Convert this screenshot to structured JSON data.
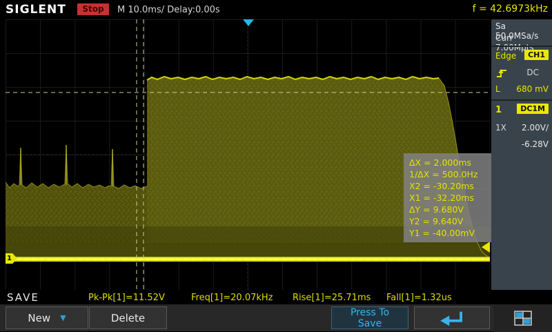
{
  "colors": {
    "accent_yellow": "#e8e800",
    "accent_cyan": "#2fb0e0",
    "stop_red": "#c53232",
    "trace_olive": "#5a5a0f",
    "sidebar_gray": "#39434b"
  },
  "top_bar": {
    "brand": "SIGLENT",
    "run_state": "Stop",
    "timebase": "M 10.0ms/ Delay:0.00s",
    "freq_counter": "f = 42.6973kHz"
  },
  "sidebar": {
    "sample_rate": "Sa 50.0MSa/s",
    "memory_depth": "Curr 7.00Mpts",
    "trigger": {
      "mode": "Edge",
      "source": "CH1",
      "coupling": "DC",
      "level_label": "L",
      "level_value": "680 mV"
    },
    "channel": {
      "id": "1",
      "coupling": "DC1M",
      "probe": "1X",
      "scale": "2.00V/",
      "offset": "-6.28V"
    }
  },
  "cursor_readout": {
    "lines": [
      "ΔX = 2.000ms",
      "1/ΔX = 500.0Hz",
      "X2 = -30.20ms",
      "X1 = -32.20ms",
      "ΔY = 9.680V",
      "Y2 = 9.640V",
      "Y1 = -40.00mV"
    ]
  },
  "status_bar": {
    "mode": "SAVE",
    "measurements": [
      "Pk-Pk[1]=11.52V",
      "Freq[1]=20.07kHz",
      "Rise[1]=25.71ms",
      "Fall[1]=1.32us"
    ]
  },
  "menu_bar": {
    "new_label": "New",
    "delete_label": "Delete",
    "save_line1": "Press To",
    "save_line2": "Save"
  },
  "markers": {
    "channel_marker": "1"
  }
}
